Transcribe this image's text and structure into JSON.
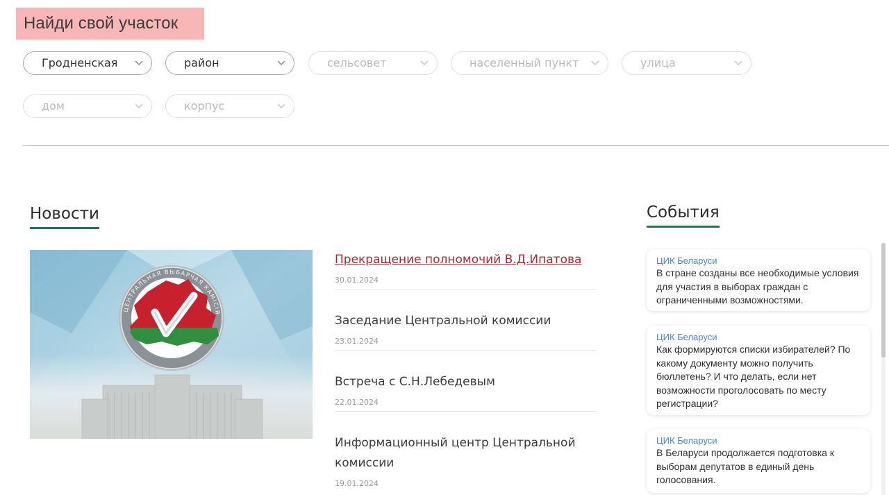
{
  "finder": {
    "title": "Найди свой участок",
    "selects": [
      {
        "value": "Гродненская",
        "state": "active"
      },
      {
        "value": "район",
        "state": "active"
      },
      {
        "value": "сельсовет",
        "state": "disabled"
      },
      {
        "value": "населенный пункт",
        "state": "disabled"
      },
      {
        "value": "улица",
        "state": "disabled"
      },
      {
        "value": "дом",
        "state": "disabled"
      },
      {
        "value": "корпус",
        "state": "disabled"
      }
    ]
  },
  "news": {
    "heading": "Новости",
    "items": [
      {
        "title": "Прекращение полномочий В.Д.Ипатова",
        "date": "30.01.2024"
      },
      {
        "title": "Заседание Центральной комиссии",
        "date": "23.01.2024"
      },
      {
        "title": "Встреча с С.Н.Лебедевым",
        "date": "22.01.2024"
      },
      {
        "title": "Информационный центр Центральной комиссии",
        "date": "19.01.2024"
      }
    ]
  },
  "events": {
    "heading": "События",
    "items": [
      {
        "source": "ЦИК Беларуси",
        "text": "В стране созданы все необходимые условия для участия в выборах граждан с ограниченными возможностями."
      },
      {
        "source": "ЦИК Беларуси",
        "text": "Как формируются списки избирателей? По какому документу можно получить бюллетень? И что делать, если нет возможности проголосовать по месту регистрации?"
      },
      {
        "source": "ЦИК Беларуси",
        "text": "В Беларуси продолжается подготовка к выборам депутатов в единый день голосования."
      }
    ]
  },
  "emblem": {
    "ring_text": "ЦЕНТРАЛЬНАЯ ВЫБАРЧАЯ КАМІСІЯ"
  },
  "colors": {
    "highlight": "#f8b6b6",
    "accent_green": "#1f7a3f",
    "link_red": "#b0282f",
    "source_blue": "#4a86c8"
  }
}
